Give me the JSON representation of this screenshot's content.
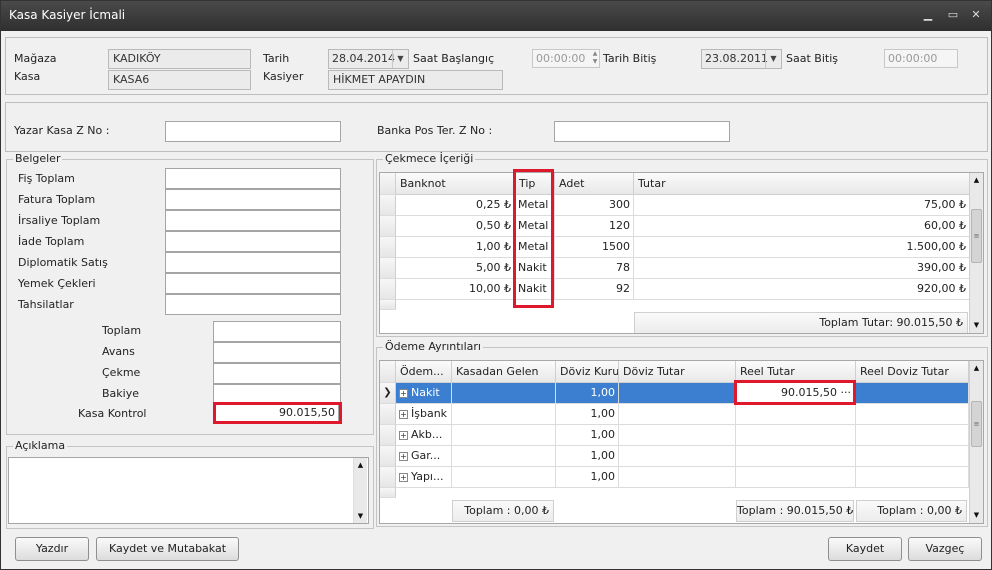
{
  "window": {
    "title": "Kasa Kasiyer İcmali"
  },
  "header": {
    "magaza_label": "Mağaza",
    "magaza_value": "KADIKÖY",
    "kasa_label": "Kasa",
    "kasa_value": "KASA6",
    "tarih_label": "Tarih",
    "tarih_value": "28.04.2014",
    "kasiyer_label": "Kasiyer",
    "kasiyer_value": "HİKMET APAYDIN",
    "saat_baslangic_label": "Saat Başlangıç",
    "saat_baslangic_value": "00:00:00",
    "tarih_bitis_label": "Tarih Bitiş",
    "tarih_bitis_value": "23.08.2011",
    "saat_bitis_label": "Saat Bitiş",
    "saat_bitis_value": "00:00:00"
  },
  "zno": {
    "yazar_label": "Yazar Kasa Z No :",
    "banka_label": "Banka Pos Ter. Z No :"
  },
  "belgeler": {
    "caption": "Belgeler",
    "items": [
      "Fiş Toplam",
      "Fatura Toplam",
      "İrsaliye Toplam",
      "İade Toplam",
      "Diplomatik Satış",
      "Yemek Çekleri",
      "Tahsilatlar"
    ],
    "toplam_label": "Toplam",
    "avans_label": "Avans",
    "cekme_label": "Çekme",
    "bakiye_label": "Bakiye",
    "kasa_kontrol_label": "Kasa Kontrol",
    "kasa_kontrol_value": "90.015,50"
  },
  "aciklama": {
    "caption": "Açıklama"
  },
  "cekmece": {
    "caption": "Çekmece İçeriği",
    "columns": [
      "Banknot",
      "Tip",
      "Adet",
      "Tutar"
    ],
    "rows": [
      {
        "banknot": "0,25 ₺",
        "tip": "Metal",
        "adet": "300",
        "tutar": "75,00 ₺"
      },
      {
        "banknot": "0,50 ₺",
        "tip": "Metal",
        "adet": "120",
        "tutar": "60,00 ₺"
      },
      {
        "banknot": "1,00 ₺",
        "tip": "Metal",
        "adet": "1500",
        "tutar": "1.500,00 ₺"
      },
      {
        "banknot": "5,00 ₺",
        "tip": "Nakit",
        "adet": "78",
        "tutar": "390,00 ₺"
      },
      {
        "banknot": "10,00 ₺",
        "tip": "Nakit",
        "adet": "92",
        "tutar": "920,00 ₺"
      }
    ],
    "footer": "Toplam Tutar: 90.015,50 ₺"
  },
  "odeme": {
    "caption": "Ödeme Ayrıntıları",
    "columns": [
      "Ödem...",
      "Kasadan Gelen",
      "Döviz Kuru",
      "Döviz Tutar",
      "Reel Tutar",
      "Reel Doviz Tutar"
    ],
    "rows": [
      {
        "name": "Nakit",
        "kur": "1,00",
        "reel": "90.015,50"
      },
      {
        "name": "İşbank",
        "kur": "1,00",
        "reel": ""
      },
      {
        "name": "Akb...",
        "kur": "1,00",
        "reel": ""
      },
      {
        "name": "Gar...",
        "kur": "1,00",
        "reel": ""
      },
      {
        "name": "Yapı...",
        "kur": "1,00",
        "reel": ""
      }
    ],
    "footer_kasadan": "Toplam : 0,00 ₺",
    "footer_reel": "Toplam : 90.015,50 ₺",
    "footer_reel_doviz": "Toplam : 0,00 ₺"
  },
  "buttons": {
    "yazdir": "Yazdır",
    "kaydet_mutabakat": "Kaydet ve Mutabakat",
    "kaydet": "Kaydet",
    "vazgec": "Vazgeç"
  }
}
